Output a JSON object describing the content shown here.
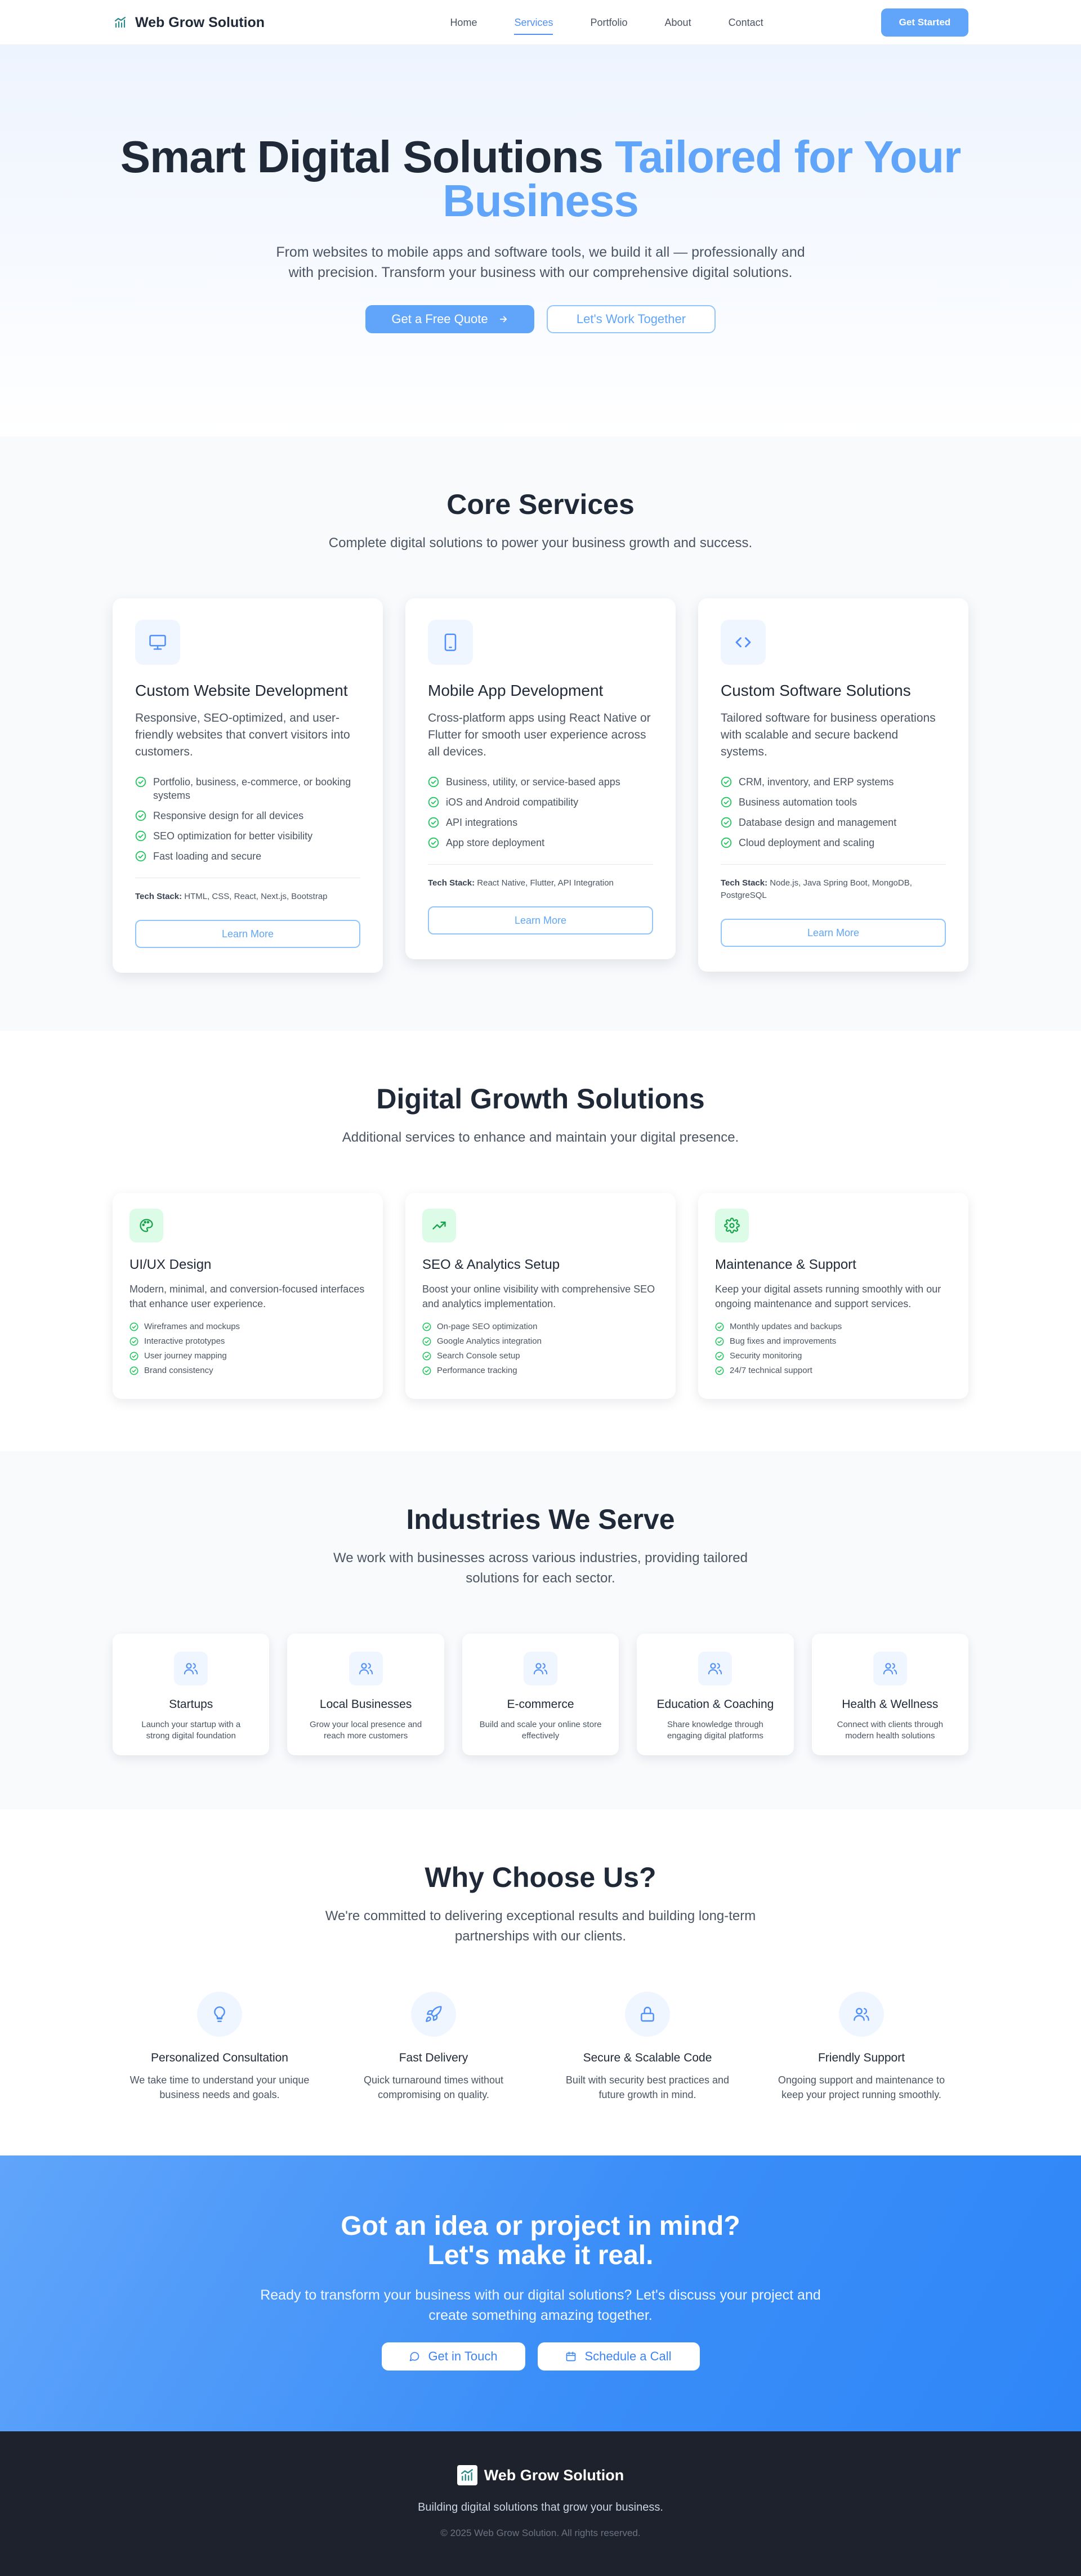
{
  "nav": {
    "brand": "Web Grow Solution",
    "links": [
      "Home",
      "Services",
      "Portfolio",
      "About",
      "Contact"
    ],
    "active": "Services",
    "cta": "Get Started"
  },
  "hero": {
    "title_main": "Smart Digital Solutions",
    "title_accent": "Tailored for Your Business",
    "subtitle": "From websites to mobile apps and software tools, we build it all — professionally and with precision. Transform your business with our comprehensive digital solutions.",
    "btn_primary": "Get a Free Quote",
    "btn_secondary": "Let's Work Together"
  },
  "core": {
    "title": "Core Services",
    "subtitle": "Complete digital solutions to power your business growth and success.",
    "cards": [
      {
        "icon": "monitor-icon",
        "title": "Custom Website Development",
        "desc": "Responsive, SEO-optimized, and user-friendly websites that convert visitors into customers.",
        "features": [
          "Portfolio, business, e-commerce, or booking systems",
          "Responsive design for all devices",
          "SEO optimization for better visibility",
          "Fast loading and secure"
        ],
        "stack_label": "Tech Stack:",
        "stack": "HTML, CSS, React, Next.js, Bootstrap",
        "btn": "Learn More"
      },
      {
        "icon": "smartphone-icon",
        "title": "Mobile App Development",
        "desc": "Cross-platform apps using React Native or Flutter for smooth user experience across all devices.",
        "features": [
          "Business, utility, or service-based apps",
          "iOS and Android compatibility",
          "API integrations",
          "App store deployment"
        ],
        "stack_label": "Tech Stack:",
        "stack": "React Native, Flutter, API Integration",
        "btn": "Learn More"
      },
      {
        "icon": "code-icon",
        "title": "Custom Software Solutions",
        "desc": "Tailored software for business operations with scalable and secure backend systems.",
        "features": [
          "CRM, inventory, and ERP systems",
          "Business automation tools",
          "Database design and management",
          "Cloud deployment and scaling"
        ],
        "stack_label": "Tech Stack:",
        "stack": "Node.js, Java Spring Boot, MongoDB, PostgreSQL",
        "btn": "Learn More"
      }
    ]
  },
  "growth": {
    "title": "Digital Growth Solutions",
    "subtitle": "Additional services to enhance and maintain your digital presence.",
    "cards": [
      {
        "icon": "palette-icon",
        "title": "UI/UX Design",
        "desc": "Modern, minimal, and conversion-focused interfaces that enhance user experience.",
        "features": [
          "Wireframes and mockups",
          "Interactive prototypes",
          "User journey mapping",
          "Brand consistency"
        ]
      },
      {
        "icon": "trending-up-icon",
        "title": "SEO & Analytics Setup",
        "desc": "Boost your online visibility with comprehensive SEO and analytics implementation.",
        "features": [
          "On-page SEO optimization",
          "Google Analytics integration",
          "Search Console setup",
          "Performance tracking"
        ]
      },
      {
        "icon": "settings-icon",
        "title": "Maintenance & Support",
        "desc": "Keep your digital assets running smoothly with our ongoing maintenance and support services.",
        "features": [
          "Monthly updates and backups",
          "Bug fixes and improvements",
          "Security monitoring",
          "24/7 technical support"
        ]
      }
    ]
  },
  "industries": {
    "title": "Industries We Serve",
    "subtitle": "We work with businesses across various industries, providing tailored solutions for each sector.",
    "items": [
      {
        "title": "Startups",
        "desc": "Launch your startup with a strong digital foundation"
      },
      {
        "title": "Local Businesses",
        "desc": "Grow your local presence and reach more customers"
      },
      {
        "title": "E-commerce",
        "desc": "Build and scale your online store effectively"
      },
      {
        "title": "Education & Coaching",
        "desc": "Share knowledge through engaging digital platforms"
      },
      {
        "title": "Health & Wellness",
        "desc": "Connect with clients through modern health solutions"
      }
    ]
  },
  "why": {
    "title": "Why Choose Us?",
    "subtitle": "We're committed to delivering exceptional results and building long-term partnerships with our clients.",
    "items": [
      {
        "icon": "lightbulb-icon",
        "title": "Personalized Consultation",
        "desc": "We take time to understand your unique business needs and goals."
      },
      {
        "icon": "rocket-icon",
        "title": "Fast Delivery",
        "desc": "Quick turnaround times without compromising on quality."
      },
      {
        "icon": "lock-icon",
        "title": "Secure & Scalable Code",
        "desc": "Built with security best practices and future growth in mind."
      },
      {
        "icon": "users-icon",
        "title": "Friendly Support",
        "desc": "Ongoing support and maintenance to keep your project running smoothly."
      }
    ]
  },
  "cta": {
    "title_line1": "Got an idea or project in mind?",
    "title_line2": "Let's make it real.",
    "subtitle": "Ready to transform your business with our digital solutions? Let's discuss your project and create something amazing together.",
    "btn_touch": "Get in Touch",
    "btn_call": "Schedule a Call"
  },
  "footer": {
    "brand": "Web Grow Solution",
    "tagline": "Building digital solutions that grow your business.",
    "copyright": "© 2025 Web Grow Solution. All rights reserved."
  },
  "colors": {
    "accent": "#60a5fa",
    "check_green": "#22c55e",
    "footer_bg": "#1e222d"
  }
}
